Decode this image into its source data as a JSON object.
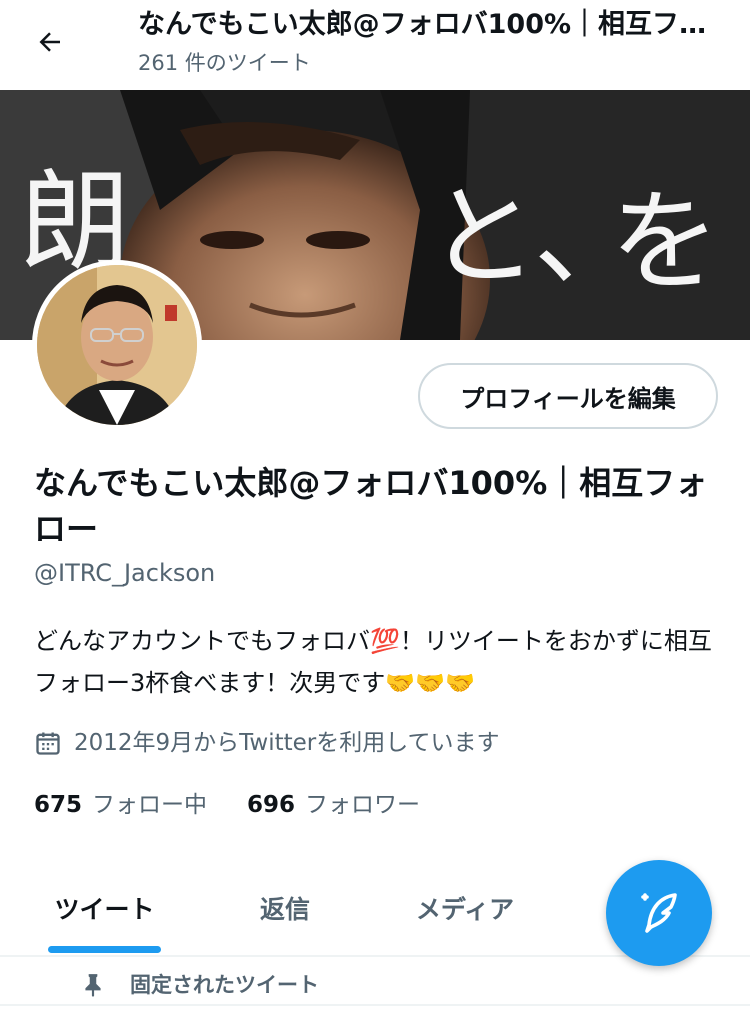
{
  "header": {
    "title": "なんでもこい太郎@フォロバ100%｜相互フォロー",
    "tweet_count": "261 件のツイート",
    "back_icon": "arrow-left-icon"
  },
  "banner": {
    "chars": [
      "朗",
      "と、",
      "を"
    ]
  },
  "profile": {
    "edit_button": "プロフィールを編集",
    "display_name": "なんでもこい太郎@フォロバ100%｜相互フォロー",
    "handle": "@ITRC_Jackson",
    "bio": "どんなアカウントでもフォロバ💯！リツイートをおかずに相互フォロー3杯食べます！次男です🤝🤝🤝",
    "joined": "2012年9月からTwitterを利用しています",
    "following_count": "675",
    "following_label": "フォロー中",
    "followers_count": "696",
    "followers_label": "フォロワー"
  },
  "tabs": [
    "ツイート",
    "返信",
    "メディア"
  ],
  "active_tab": "ツイート",
  "pinned_label": "固定されたツイート",
  "colors": {
    "accent": "#1d9bf0",
    "text": "#0f1419",
    "secondary": "#536471"
  }
}
